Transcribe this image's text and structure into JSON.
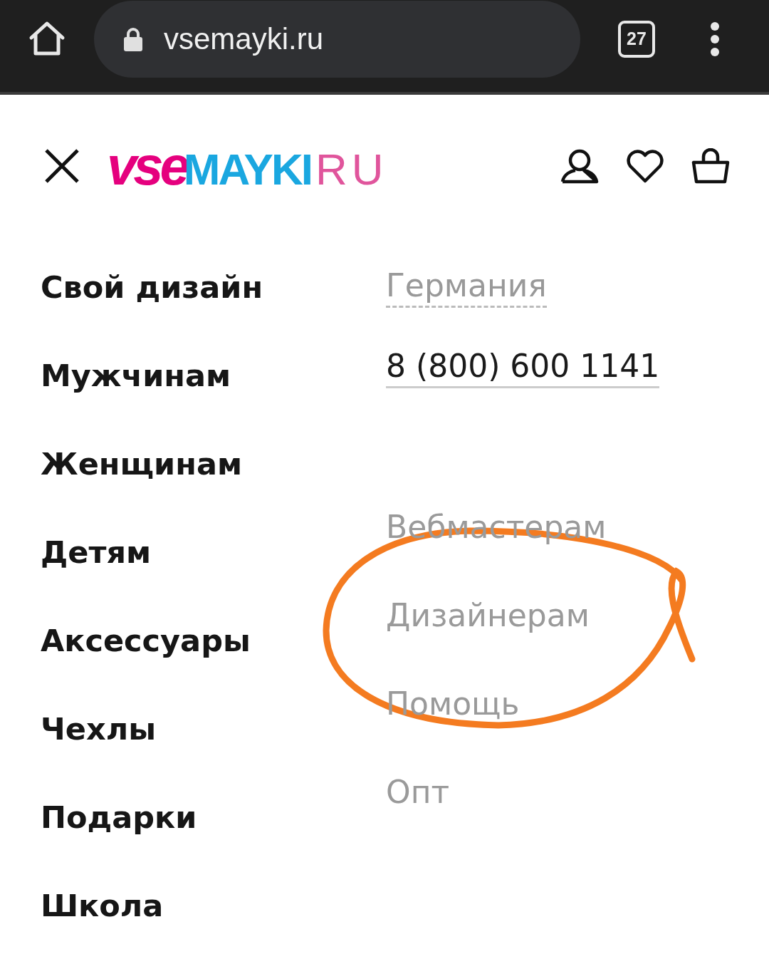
{
  "browser": {
    "url": "vsemayki.ru",
    "tab_count": "27"
  },
  "header": {
    "logo": {
      "part_1": "vse",
      "part_2": "MAYKI",
      "part_3": "RU"
    }
  },
  "menu": [
    "Свой дизайн",
    "Мужчинам",
    "Женщинам",
    "Детям",
    "Аксессуары",
    "Чехлы",
    "Подарки",
    "Школа"
  ],
  "aside": {
    "region": "Германия",
    "phone": "8 (800) 600 1141",
    "links": [
      "Вебмастерам",
      "Дизайнерам",
      "Помощь",
      "Опт"
    ]
  }
}
